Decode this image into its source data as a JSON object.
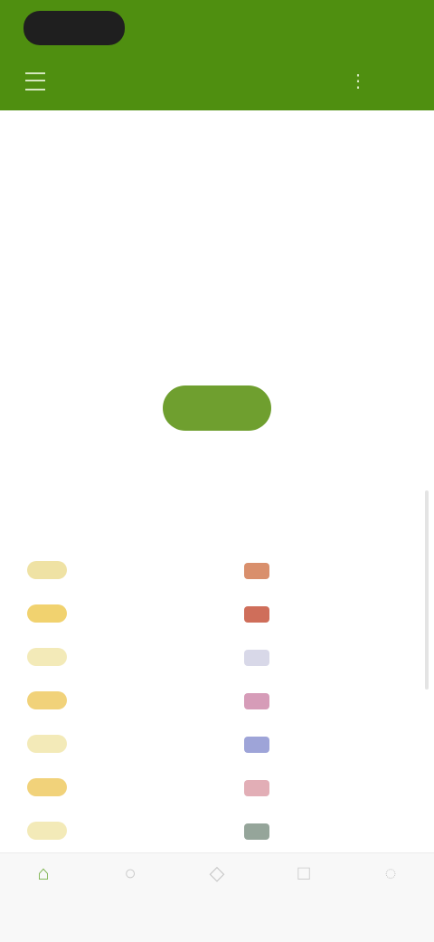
{
  "header": {
    "auth_label": "",
    "site_title": "",
    "more_icon": "⋮"
  },
  "intro": {
    "title": "",
    "subtext_prefix": "",
    "subtext_emphasis": "",
    "subtext_suffix": ""
  },
  "stats": [
    {
      "label": "",
      "value": ""
    },
    {
      "label": "",
      "value": ""
    },
    {
      "label": "",
      "value": ""
    },
    {
      "label": "",
      "value": ""
    }
  ],
  "cta": {
    "label": ""
  },
  "table": {
    "title": "",
    "headers": [
      "",
      "",
      "",
      ""
    ],
    "rows": [
      {
        "rank": "",
        "name": "",
        "flag_color": "#d98f6c",
        "amount": "",
        "badge_color": "#efe2a4"
      },
      {
        "rank": "",
        "name": "",
        "flag_color": "#cf6e5a",
        "amount": "",
        "badge_color": "#f1d26f"
      },
      {
        "rank": "",
        "name": "",
        "flag_color": "#d8d8e8",
        "amount": "",
        "badge_color": "#f3eab8"
      },
      {
        "rank": "",
        "name": "",
        "flag_color": "#d69cb8",
        "amount": "",
        "badge_color": "#f1d27a"
      },
      {
        "rank": "",
        "name": "",
        "flag_color": "#9ea4d8",
        "amount": "",
        "badge_color": "#f3eab8"
      },
      {
        "rank": "",
        "name": "",
        "flag_color": "#e2aeb6",
        "amount": "",
        "badge_color": "#f1d27a"
      },
      {
        "rank": "",
        "name": "",
        "flag_color": "#95a59a",
        "amount": "",
        "badge_color": "#f3eab8"
      }
    ]
  },
  "bottom_nav": [
    {
      "icon": "⌂",
      "label": ""
    },
    {
      "icon": "○",
      "label": ""
    },
    {
      "icon": "◇",
      "label": ""
    },
    {
      "icon": "□",
      "label": ""
    },
    {
      "icon": "◌",
      "label": ""
    }
  ],
  "colors": {
    "brand": "#4f8f10",
    "accent": "#6ea32c"
  }
}
